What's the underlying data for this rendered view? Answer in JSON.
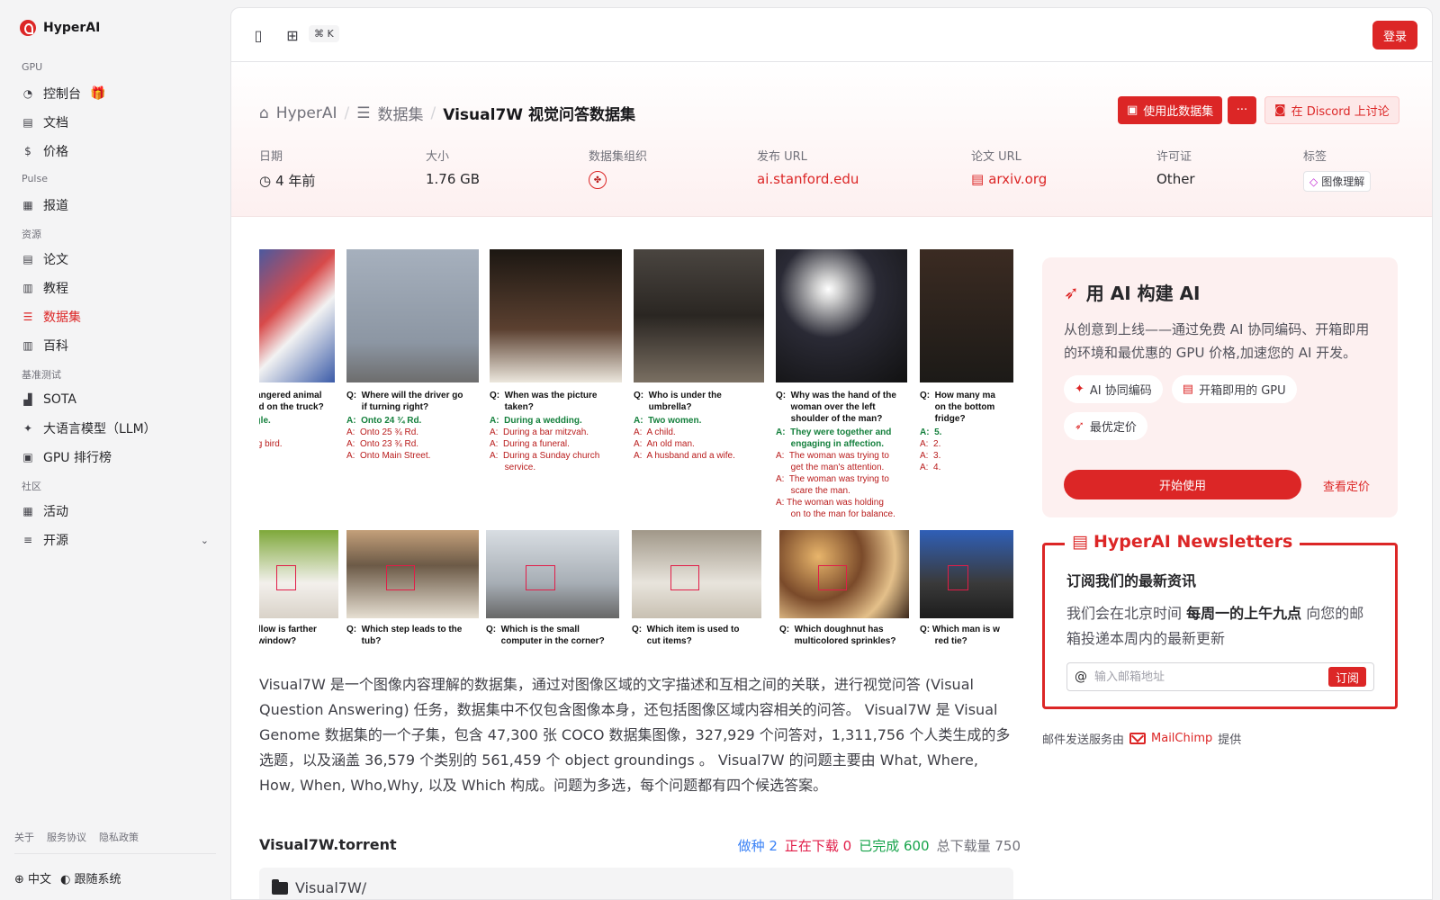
{
  "sidebar": {
    "brand": "HyperAI",
    "sections": [
      {
        "title": "GPU",
        "items": [
          {
            "label": "控制台",
            "icon": "dashboard-icon",
            "glyph": "◔",
            "gift": true
          },
          {
            "label": "文档",
            "icon": "document-icon",
            "glyph": "▤"
          },
          {
            "label": "价格",
            "icon": "dollar-icon",
            "glyph": "$"
          }
        ]
      },
      {
        "title": "Pulse",
        "items": [
          {
            "label": "报道",
            "icon": "newspaper-icon",
            "glyph": "▦"
          }
        ]
      },
      {
        "title": "资源",
        "items": [
          {
            "label": "论文",
            "icon": "paper-icon",
            "glyph": "▤"
          },
          {
            "label": "教程",
            "icon": "book-icon",
            "glyph": "▥"
          },
          {
            "label": "数据集",
            "icon": "database-icon",
            "glyph": "☰",
            "active": true
          },
          {
            "label": "百科",
            "icon": "encyclopedia-icon",
            "glyph": "▥"
          }
        ]
      },
      {
        "title": "基准测试",
        "items": [
          {
            "label": "SOTA",
            "icon": "chart-icon",
            "glyph": "▟"
          },
          {
            "label": "大语言模型（LLM）",
            "icon": "sparkle-icon",
            "glyph": "✦"
          },
          {
            "label": "GPU 排行榜",
            "icon": "chip-icon",
            "glyph": "▣"
          }
        ]
      },
      {
        "title": "社区",
        "items": [
          {
            "label": "活动",
            "icon": "calendar-icon",
            "glyph": "▦"
          },
          {
            "label": "开源",
            "icon": "list-icon",
            "glyph": "≡",
            "chevron": true
          }
        ]
      }
    ],
    "footer_links": [
      "关于",
      "服务协议",
      "隐私政策"
    ],
    "language": "中文",
    "theme": "跟随系统"
  },
  "topbar": {
    "shortcut": "⌘ K",
    "login_label": "登录"
  },
  "breadcrumb": {
    "home": "HyperAI",
    "section": "数据集",
    "current": "Visual7W 视觉问答数据集"
  },
  "actions": {
    "use_dataset": "使用此数据集",
    "more": "···",
    "discord": "在 Discord 上讨论"
  },
  "meta": {
    "date_label": "日期",
    "date_value": "4 年前",
    "size_label": "大小",
    "size_value": "1.76 GB",
    "org_label": "数据集组织",
    "url_label": "发布 URL",
    "url_value": "ai.stanford.edu",
    "paper_label": "论文 URL",
    "paper_value": "arxiv.org",
    "license_label": "许可证",
    "license_value": "Other",
    "tags_label": "标签",
    "tag_value": "图像理解"
  },
  "figure": {
    "top": [
      {
        "q": "dangered animal\nred on the truck?",
        "answers": [
          {
            "t": "agle.",
            "ok": true
          },
          {
            "t": "w."
          },
          {
            "t": "ing bird."
          }
        ]
      },
      {
        "q": "Q:  Where will the driver go\n      if turning right?",
        "answers": [
          {
            "t": "A:  Onto 24 ¾ Rd.",
            "ok": true
          },
          {
            "t": "A:  Onto 25 ¾ Rd."
          },
          {
            "t": "A:  Onto 23 ¾ Rd."
          },
          {
            "t": "A:  Onto Main Street."
          }
        ]
      },
      {
        "q": "Q:  When was the picture\n      taken?",
        "answers": [
          {
            "t": "A:  During a wedding.",
            "ok": true
          },
          {
            "t": "A:  During a bar mitzvah."
          },
          {
            "t": "A:  During a funeral."
          },
          {
            "t": "A:  During a Sunday church\n      service."
          }
        ]
      },
      {
        "q": "Q:  Who is under the\n      umbrella?",
        "answers": [
          {
            "t": "A:  Two women.",
            "ok": true
          },
          {
            "t": "A:  A child."
          },
          {
            "t": "A:  An old man."
          },
          {
            "t": "A:  A husband and a wife."
          }
        ]
      },
      {
        "q": "Q:  Why was the hand of the\n      woman over the left\n      shoulder of the man?",
        "answers": [
          {
            "t": "A:  They were together and\n      engaging in affection.",
            "ok": true
          },
          {
            "t": "A:  The woman was trying to\n      get the man's attention."
          },
          {
            "t": "A:  The woman was trying to\n      scare the man."
          },
          {
            "t": "A: The woman was holding\n      on to the man for balance."
          }
        ]
      },
      {
        "q": "Q:  How many ma\n      on the bottom\n      fridge?",
        "answers": [
          {
            "t": "A:  5.",
            "ok": true
          },
          {
            "t": "A:  2."
          },
          {
            "t": "A:  3."
          },
          {
            "t": "A:  4."
          }
        ]
      }
    ],
    "bottom": [
      "pillow is farther\ne window?",
      "Q:  Which step leads to the\n      tub?",
      "Q:  Which is the small\n      computer in the corner?",
      "Q:  Which item is used to\n      cut items?",
      "Q:  Which doughnut has\n      multicolored sprinkles?",
      "Q: Which man is w\n      red tie?"
    ]
  },
  "description": "Visual7W 是一个图像内容理解的数据集，通过对图像区域的文字描述和互相之间的关联，进行视觉问答 (Visual Question Answering) 任务，数据集中不仅包含图像本身，还包括图像区域内容相关的问答。 Visual7W 是 Visual Genome 数据集的一个子集，包含 47,300 张 COCO 数据集图像，327,929 个问答对，1,311,756 个人类生成的多选题，以及涵盖 36,579 个类别的 561,459 个 object groundings 。 Visual7W 的问题主要由 What, Where, How, When, Who,Why, 以及 Which 构成。问题为多选，每个问题都有四个候选答案。",
  "torrent": {
    "name": "Visual7W.torrent",
    "seeding": "做种 2",
    "downloading": "正在下载 0",
    "completed": "已完成 600",
    "total": "总下载量 750",
    "folder": "Visual7W/"
  },
  "promo": {
    "title": "用 AI 构建 AI",
    "body": "从创意到上线——通过免费 AI 协同编码、开箱即用的环境和最优惠的 GPU 价格,加速您的 AI 开发。",
    "chips": [
      {
        "label": "AI 协同编码",
        "icon": "sparkle-icon",
        "glyph": "✦"
      },
      {
        "label": "开箱即用的 GPU",
        "icon": "server-icon",
        "glyph": "▤"
      },
      {
        "label": "最优定价",
        "icon": "rocket-icon",
        "glyph": "➶"
      }
    ],
    "start_label": "开始使用",
    "pricing_label": "查看定价"
  },
  "newsletter": {
    "title": "HyperAI Newsletters",
    "heading": "订阅我们的最新资讯",
    "body_pre": "我们会在北京时间 ",
    "body_bold": "每周一的上午九点",
    "body_post": " 向您的邮箱投递本周内的最新更新",
    "placeholder": "输入邮箱地址",
    "subscribe_label": "订阅"
  },
  "mail_note": {
    "pre": "邮件发送服务由",
    "brand": "MailChimp",
    "post": "提供"
  },
  "colors": {
    "accent": "#dc2626",
    "sidebar_bg": "#f4f4f5"
  }
}
